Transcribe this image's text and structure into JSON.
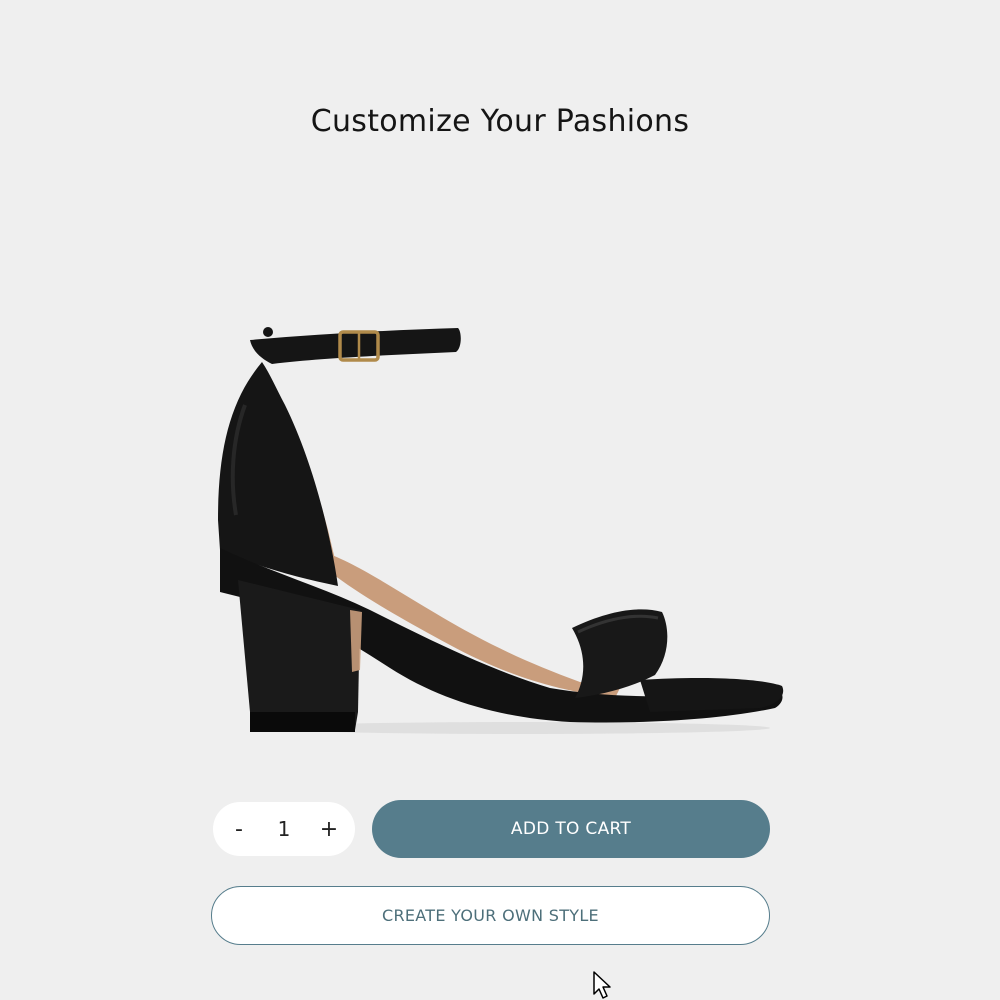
{
  "header": {
    "title": "Customize Your Pashions"
  },
  "product": {
    "image_icon": "black-block-heel-sandal",
    "colors": {
      "leather": "#151515",
      "lining": "#c99d7c",
      "buckle": "#b08a4a"
    }
  },
  "quantity": {
    "decrement_label": "-",
    "value": "1",
    "increment_label": "+"
  },
  "actions": {
    "add_to_cart_label": "ADD TO CART",
    "create_style_label": "CREATE YOUR OWN STYLE"
  },
  "colors": {
    "background": "#efefef",
    "accent": "#567d8c",
    "button_text": "#ffffff"
  }
}
